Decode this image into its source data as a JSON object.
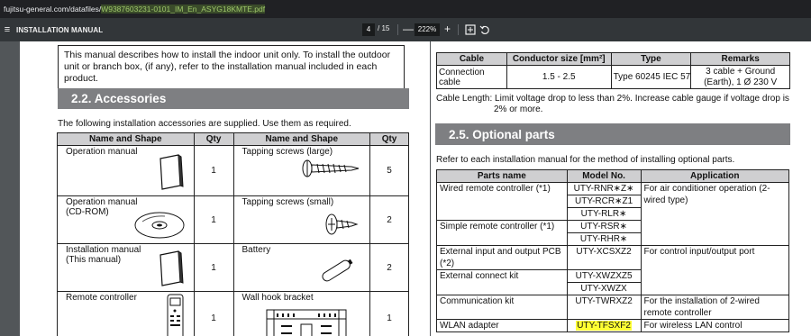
{
  "browser": {
    "url_host": "fujitsu-general.com/datafiles/",
    "url_highlight": "W9387603231-0101_IM_En_ASYG18KMTE.pdf"
  },
  "viewer": {
    "title": "INSTALLATION MANUAL",
    "page_current": "4",
    "page_sep": "/",
    "page_total": "15",
    "zoom_out": "—",
    "zoom": "222%",
    "zoom_in": "+"
  },
  "left_page": {
    "note": "This manual describes how to install the indoor unit only. To install the outdoor unit or branch box, (if any), refer to the installation manual included in each product.",
    "section_title": "2.2. Accessories",
    "intro": "The following installation accessories are supplied. Use them as required.",
    "table_headers": [
      "Name and Shape",
      "Qty",
      "Name and Shape",
      "Qty"
    ],
    "rows": [
      {
        "name1": "Operation manual",
        "qty1": "1",
        "name2": "Tapping screws (large)",
        "qty2": "5"
      },
      {
        "name1": "Operation manual\n(CD-ROM)",
        "qty1": "1",
        "name2": "Tapping screws (small)",
        "qty2": "2"
      },
      {
        "name1": "Installation manual\n(This manual)",
        "qty1": "1",
        "name2": "Battery",
        "qty2": "2"
      },
      {
        "name1": "Remote controller",
        "qty1": "1",
        "name2": "Wall hook bracket",
        "qty2": "1"
      }
    ]
  },
  "right_page": {
    "cable_headers": [
      "Cable",
      "Conductor size [mm²]",
      "Type",
      "Remarks"
    ],
    "cable_row": {
      "cable": "Connection cable",
      "size": "1.5 - 2.5",
      "type": "Type 60245 IEC 57",
      "remarks": "3 cable + Ground (Earth), 1 Ø 230 V"
    },
    "cable_length": "Cable Length: Limit voltage drop to less than 2%. Increase cable gauge if voltage drop is 2% or more.",
    "section_title": "2.5. Optional parts",
    "intro": "Refer to each installation manual for the method of installing optional parts.",
    "opt_headers": [
      "Parts name",
      "Model No.",
      "Application"
    ],
    "opt": {
      "wired": "Wired remote controller (*1)",
      "m_rnr": "UTY-RNR∗Z∗",
      "m_rcr": "UTY-RCR∗Z1",
      "m_rlr": "UTY-RLR∗",
      "app_aircon": "For air conditioner operation (2-wired type)",
      "simple": "Simple remote controller (*1)",
      "m_rsr": "UTY-RSR∗",
      "m_rhr": "UTY-RHR∗",
      "ext_io": "External input and output PCB (*2)",
      "m_xcsx": "UTY-XCSXZ2",
      "app_io": "For control input/output port",
      "ext_kit": "External connect kit",
      "m_xwzx5": "UTY-XWZXZ5",
      "m_xwzx": "UTY-XWZX",
      "comm": "Communication kit",
      "m_twr": "UTY-TWRXZ2",
      "app_comm": "For the installation of 2-wired remote controller",
      "wlan": "WLAN adapter",
      "m_tfs": "UTY-TFSXF2",
      "app_wlan": "For wireless LAN control"
    }
  },
  "colors": {
    "section_bar": "#7e7f82",
    "table_header": "#cfcfd1",
    "highlight": "#ffff33",
    "toolbar": "#323639"
  }
}
